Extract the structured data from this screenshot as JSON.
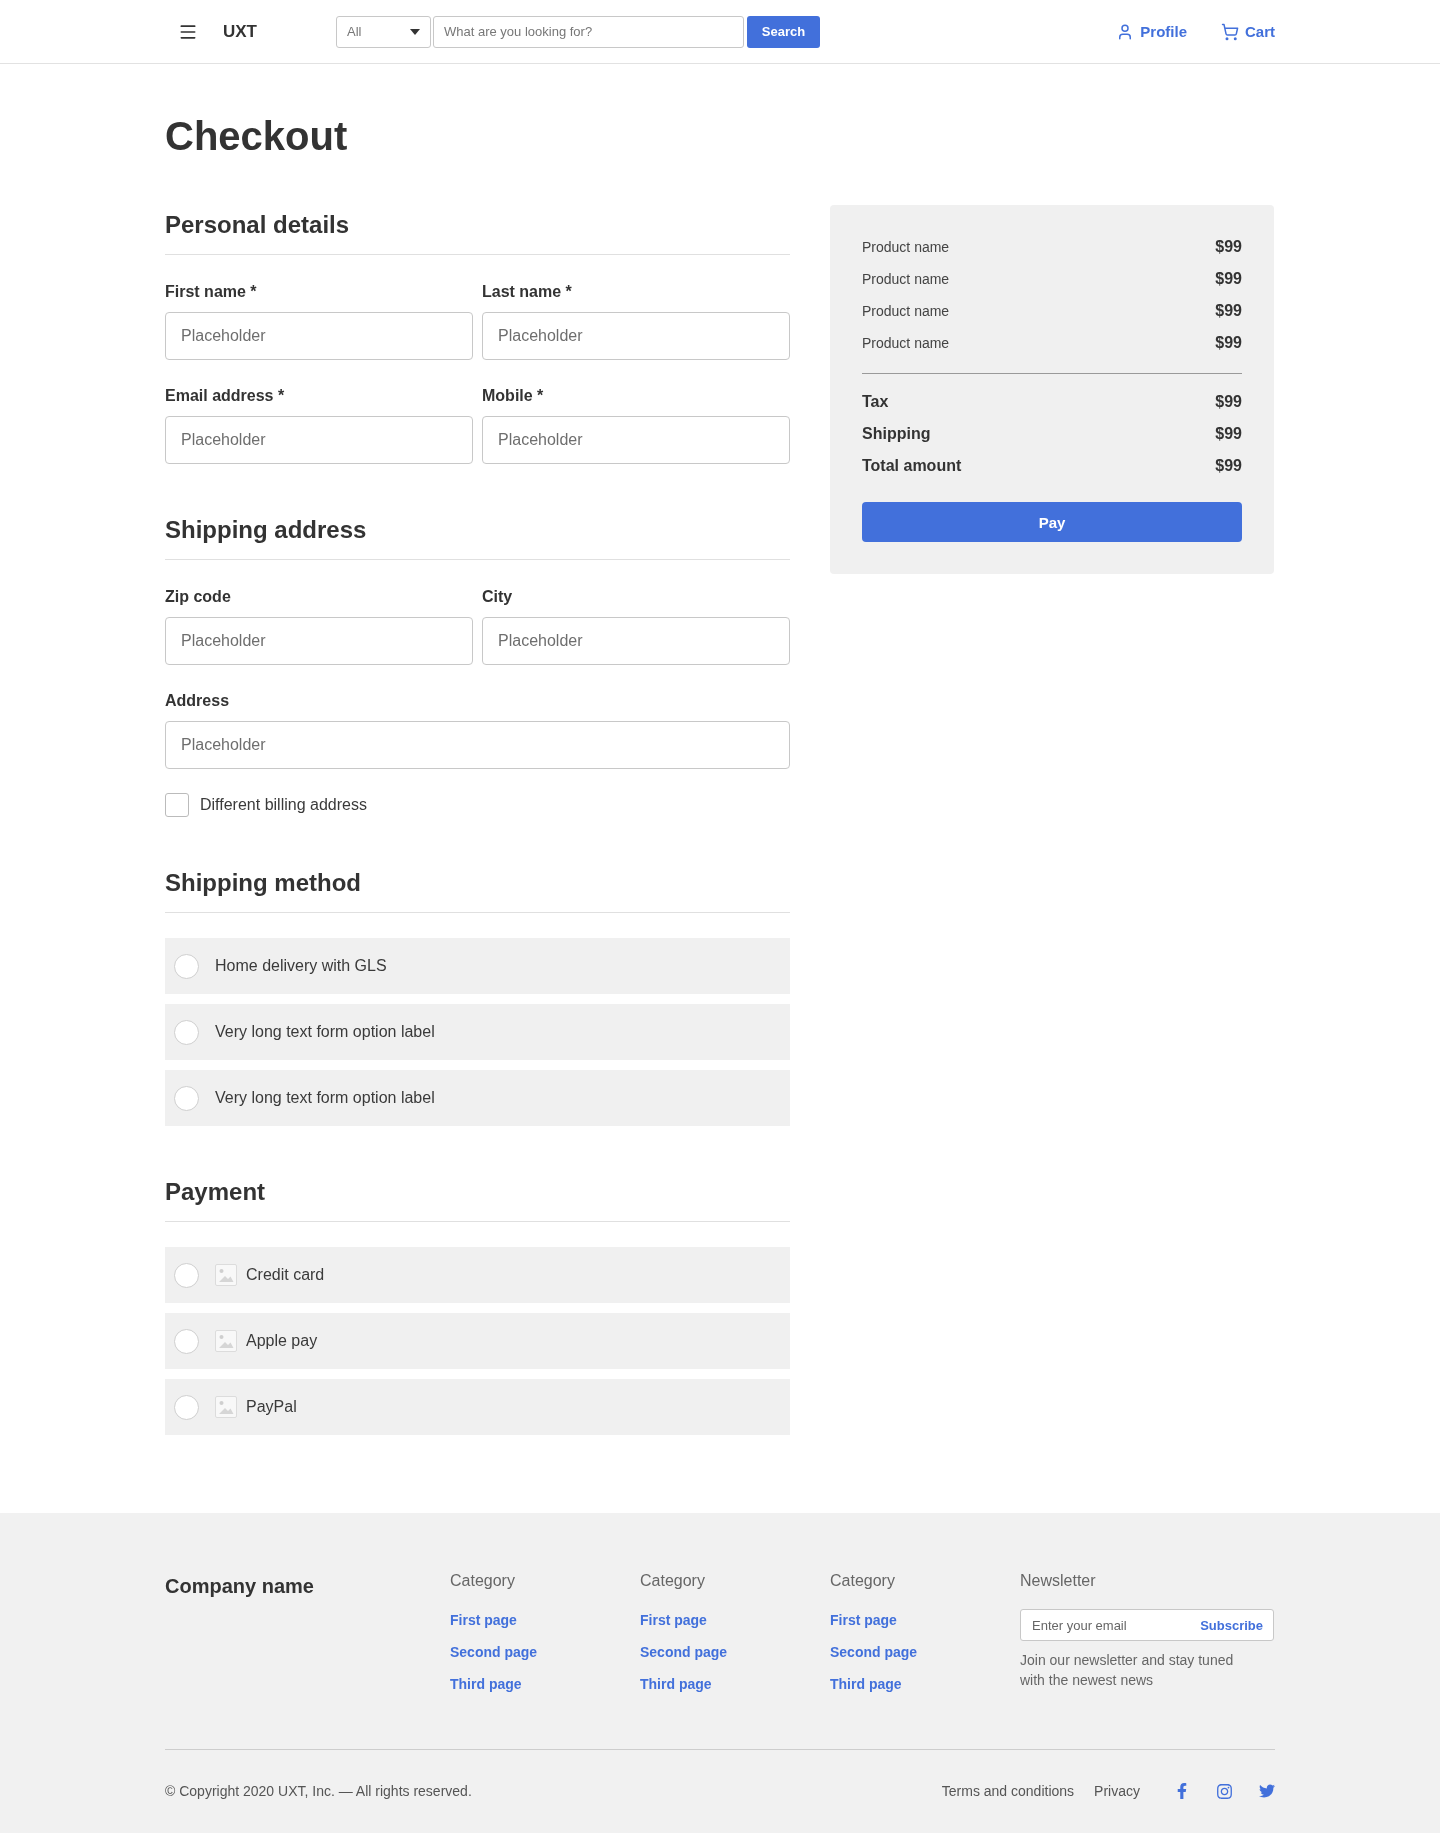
{
  "header": {
    "brand": "UXT",
    "category_select": "All",
    "search": {
      "placeholder": "What are you looking for?",
      "button": "Search"
    },
    "nav": [
      "Profile",
      "Cart"
    ]
  },
  "page_title": "Checkout",
  "sections": [
    {
      "title": "Personal details",
      "rows": [
        [
          {
            "label": "First name *",
            "placeholder": "Placeholder"
          },
          {
            "label": "Last name *",
            "placeholder": "Placeholder"
          }
        ],
        [
          {
            "label": "Email address *",
            "placeholder": "Placeholder"
          },
          {
            "label": "Mobile *",
            "placeholder": "Placeholder"
          }
        ]
      ]
    },
    {
      "title": "Shipping address",
      "rows": [
        [
          {
            "label": "Zip code",
            "placeholder": "Placeholder"
          },
          {
            "label": "City",
            "placeholder": "Placeholder"
          }
        ],
        [
          {
            "label": "Address",
            "placeholder": "Placeholder"
          }
        ]
      ],
      "checkbox": {
        "label": "Different billing address",
        "checked": false
      }
    },
    {
      "title": "Shipping method",
      "options": [
        {
          "label": "Home delivery with GLS",
          "selected": false
        },
        {
          "label": "Very long text form option label",
          "selected": false
        },
        {
          "label": "Very long text form option label",
          "selected": false
        }
      ]
    },
    {
      "title": "Payment",
      "options": [
        {
          "label": "Credit card",
          "selected": false,
          "image": true
        },
        {
          "label": "Apple pay",
          "selected": false,
          "image": true
        },
        {
          "label": "PayPal",
          "selected": false,
          "image": true
        }
      ]
    }
  ],
  "order_summary": {
    "items": [
      {
        "name": "Product name",
        "price": "$99"
      },
      {
        "name": "Product name",
        "price": "$99"
      },
      {
        "name": "Product name",
        "price": "$99"
      },
      {
        "name": "Product name",
        "price": "$99"
      }
    ],
    "totals": [
      {
        "label": "Tax",
        "value": "$99"
      },
      {
        "label": "Shipping",
        "value": "$99"
      },
      {
        "label": "Total amount",
        "value": "$99"
      }
    ],
    "button": "Pay"
  },
  "footer": {
    "company": "Company name",
    "columns": [
      {
        "title": "Category",
        "links": [
          "First page",
          "Second page",
          "Third page"
        ]
      },
      {
        "title": "Category",
        "links": [
          "First page",
          "Second page",
          "Third page"
        ]
      },
      {
        "title": "Category",
        "links": [
          "First page",
          "Second page",
          "Third page"
        ]
      }
    ],
    "newsletter": {
      "title": "Newsletter",
      "placeholder": "Enter your email",
      "button": "Subscribe",
      "note": "Join our newsletter and stay tuned with the newest news"
    },
    "copyright": "© Copyright 2020 UXT, Inc. — All rights reserved.",
    "links": [
      "Terms and conditions",
      "Privacy"
    ]
  }
}
